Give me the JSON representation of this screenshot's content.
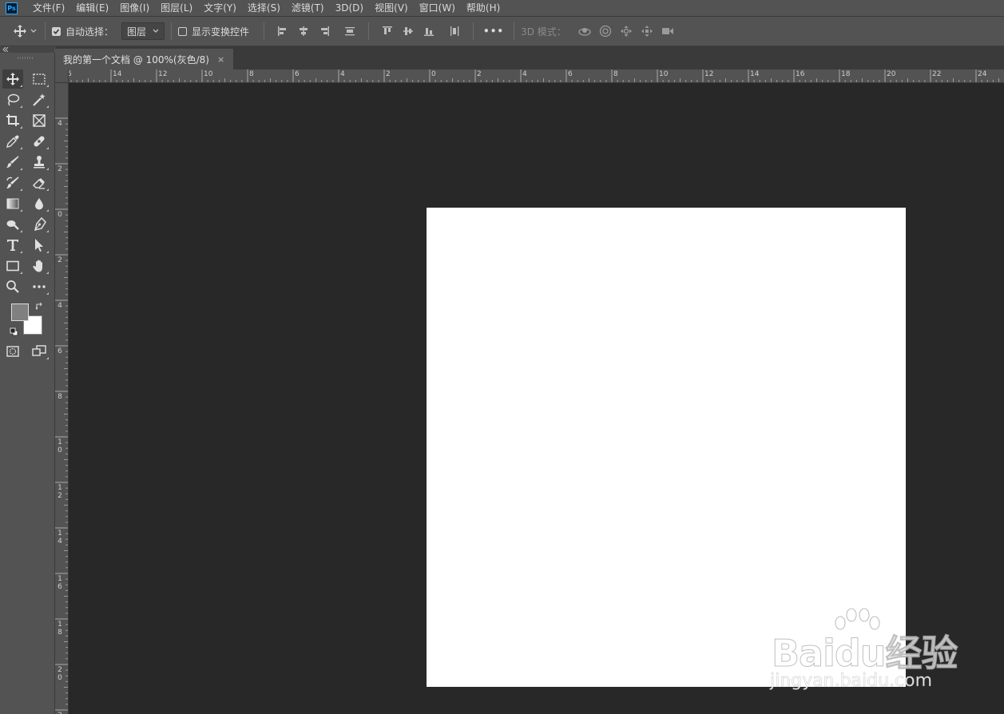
{
  "app": {
    "logo_text": "Ps"
  },
  "menu": {
    "items": [
      "文件(F)",
      "编辑(E)",
      "图像(I)",
      "图层(L)",
      "文字(Y)",
      "选择(S)",
      "滤镜(T)",
      "3D(D)",
      "视图(V)",
      "窗口(W)",
      "帮助(H)"
    ]
  },
  "options_bar": {
    "auto_select_label": "自动选择：",
    "auto_select_checked": true,
    "auto_select_target": "图层",
    "show_transform_label": "显示变换控件",
    "show_transform_checked": false,
    "more_label": "•••",
    "mode_3d_label": "3D 模式："
  },
  "document_tab": {
    "title": "我的第一个文档 @ 100%(灰色/8)",
    "close_glyph": "×"
  },
  "rulers": {
    "top_labels": [
      "6",
      "14",
      "12",
      "10",
      "8",
      "6",
      "4",
      "2",
      "0",
      "2",
      "4",
      "6",
      "8",
      "10",
      "12",
      "14",
      "16",
      "18",
      "20",
      "22",
      "24"
    ],
    "left_labels": [
      "4",
      "2",
      "0",
      "2",
      "4",
      "6",
      "8",
      "10",
      "12",
      "14",
      "16",
      "18",
      "20",
      "2"
    ]
  },
  "colors": {
    "foreground": "#808080",
    "background": "#ffffff",
    "workspace": "#282828",
    "panel": "#535353"
  },
  "watermark": {
    "brand": "Baidu经验",
    "url": "jingyan.baidu.com"
  }
}
